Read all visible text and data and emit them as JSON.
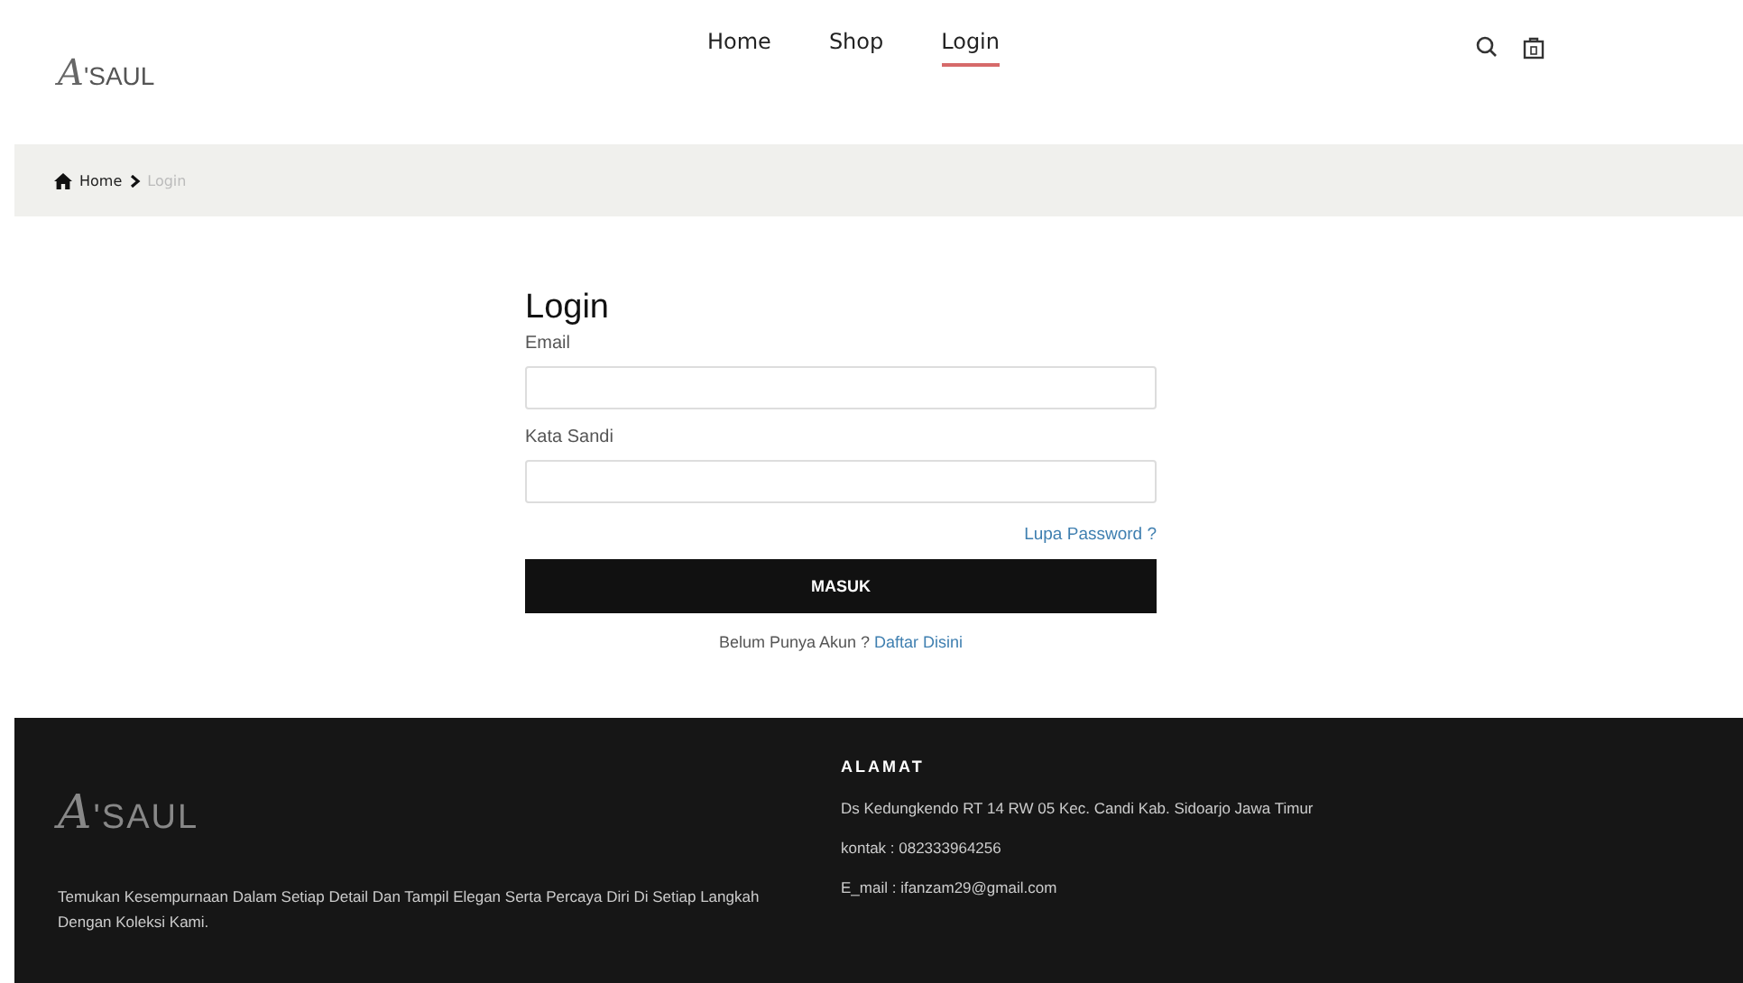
{
  "header": {
    "logo": "A'SAUL",
    "nav": [
      {
        "label": "Home",
        "selected": false
      },
      {
        "label": "Shop",
        "selected": false
      },
      {
        "label": "Login",
        "selected": true
      }
    ]
  },
  "breadcrumb": {
    "items": [
      {
        "label": "Home",
        "current": false
      },
      {
        "label": "Login",
        "current": true
      }
    ]
  },
  "login": {
    "title": "Login",
    "fields": [
      {
        "label": "Email"
      },
      {
        "label": "Kata Sandi"
      }
    ],
    "forgot": "Lupa Password ?",
    "submit": "MASUK",
    "register_prompt": "Belum Punya Akun ?",
    "register_link": "Daftar Disini"
  },
  "footer": {
    "logo": "A'SAUL",
    "tagline": "Temukan Kesempurnaan Dalam Setiap Detail Dan Tampil Elegan Serta Percaya Diri Di Setiap Langkah Dengan Koleksi Kami.",
    "address_heading": "ALAMAT",
    "address_lines": [
      "Ds Kedungkendo RT 14 RW 05 Kec. Candi Kab. Sidoarjo Jawa Timur",
      "kontak : 082333964256",
      "E_mail : ifanzam29@gmail.com"
    ]
  }
}
